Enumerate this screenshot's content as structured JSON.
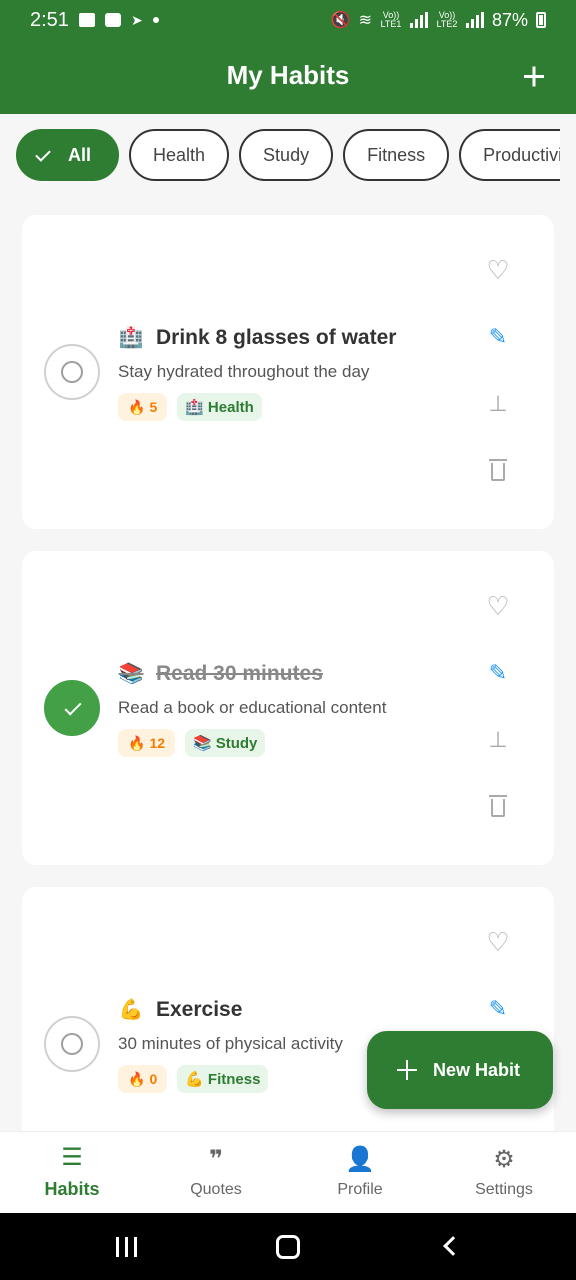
{
  "status_bar": {
    "time": "2:51",
    "sim1": "Vo)) LTE1",
    "sim2": "Vo)) LTE2",
    "battery": "87%"
  },
  "app_bar": {
    "title": "My Habits"
  },
  "filters": [
    {
      "label": "All",
      "selected": true
    },
    {
      "label": "Health",
      "selected": false
    },
    {
      "label": "Study",
      "selected": false
    },
    {
      "label": "Fitness",
      "selected": false
    },
    {
      "label": "Productivit",
      "selected": false
    }
  ],
  "habits": [
    {
      "emoji": "🏥",
      "title": "Drink 8 glasses of water",
      "description": "Stay hydrated throughout the day",
      "streak_icon": "🔥",
      "streak": "5",
      "category_emoji": "🏥",
      "category": "Health",
      "completed": false
    },
    {
      "emoji": "📚",
      "title": "Read 30 minutes",
      "description": "Read a book or educational content",
      "streak_icon": "🔥",
      "streak": "12",
      "category_emoji": "📚",
      "category": "Study",
      "completed": true
    },
    {
      "emoji": "💪",
      "title": "Exercise",
      "description": "30 minutes of physical activity",
      "streak_icon": "🔥",
      "streak": "0",
      "category_emoji": "💪",
      "category": "Fitness",
      "completed": false
    }
  ],
  "fab": {
    "label": "New Habit"
  },
  "bottom_nav": [
    {
      "label": "Habits",
      "icon": "list-icon",
      "active": true
    },
    {
      "label": "Quotes",
      "icon": "quote-icon",
      "active": false
    },
    {
      "label": "Profile",
      "icon": "person-icon",
      "active": false
    },
    {
      "label": "Settings",
      "icon": "gear-icon",
      "active": false
    }
  ],
  "colors": {
    "primary": "#2e7d32",
    "done": "#43a047",
    "streak": "#f57c00",
    "edit": "#2196f3"
  }
}
